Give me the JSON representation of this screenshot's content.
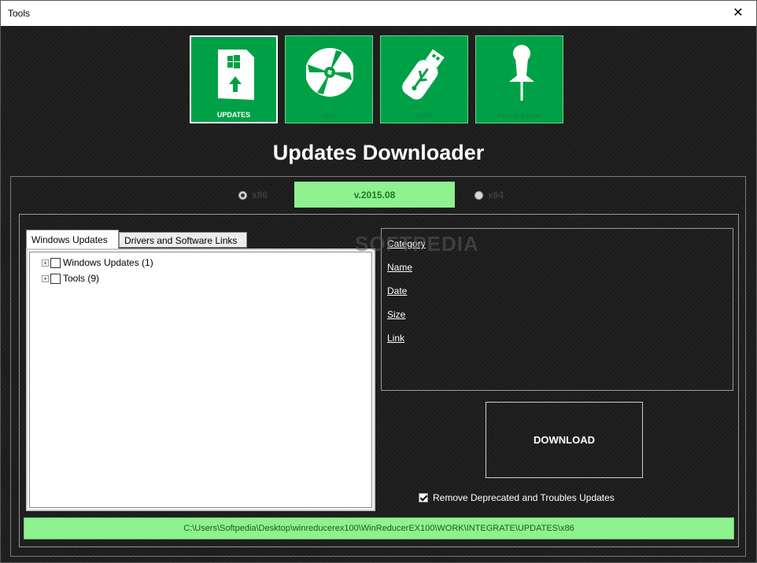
{
  "window": {
    "title": "Tools",
    "close_glyph": "✕"
  },
  "tiles": [
    {
      "label": "UPDATES",
      "icon": "windows-update-icon",
      "active": true
    },
    {
      "label": "ISO",
      "icon": "disc-icon",
      "active": false
    },
    {
      "label": "USB",
      "icon": "usb-drive-icon",
      "active": false
    },
    {
      "label": "Preset Editor",
      "icon": "pushpin-icon",
      "active": false
    }
  ],
  "heading": "Updates Downloader",
  "arch": {
    "x86": "x86",
    "x64": "x64",
    "selected": "x86"
  },
  "version": "v.2015.08",
  "tabs": {
    "active": "Windows Updates",
    "inactive": "Drivers and Software Links"
  },
  "tree": [
    {
      "label": "Windows Updates (1)",
      "expander": "+"
    },
    {
      "label": "Tools (9)",
      "expander": "+"
    }
  ],
  "details": {
    "category": "Category",
    "name": "Name",
    "date": "Date",
    "size": "Size",
    "link": "Link"
  },
  "download_label": "DOWNLOAD",
  "remove_option": {
    "label": "Remove Deprecated and Troubles Updates",
    "checked": true
  },
  "path": "C:\\Users\\Softpedia\\Desktop\\winreducerex100\\WinReducerEX100\\WORK\\INTEGRATE\\UPDATES\\x86",
  "watermark": "SOFTPEDIA",
  "colors": {
    "tile_green": "#00a146",
    "light_green": "#8ef28e",
    "background": "#1e1e1e"
  }
}
